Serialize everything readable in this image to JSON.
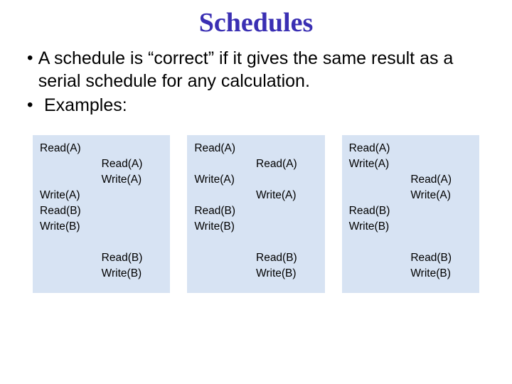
{
  "title": "Schedules",
  "bullets": [
    "A schedule is “correct” if it gives the same result as a serial schedule for any calculation.",
    "Examples:"
  ],
  "panels": [
    {
      "left": "Read(A)\n\n\nWrite(A)\nRead(B)\nWrite(B)",
      "right": "\nRead(A)\nWrite(A)\n\n\n\n\nRead(B)\nWrite(B)"
    },
    {
      "left": "Read(A)\n\nWrite(A)\n\nRead(B)\nWrite(B)",
      "right": "\nRead(A)\n\nWrite(A)\n\n\n\nRead(B)\nWrite(B)"
    },
    {
      "left": "Read(A)\nWrite(A)\n\n\nRead(B)\nWrite(B)",
      "right": "\n\nRead(A)\nWrite(A)\n\n\n\nRead(B)\nWrite(B)"
    }
  ]
}
